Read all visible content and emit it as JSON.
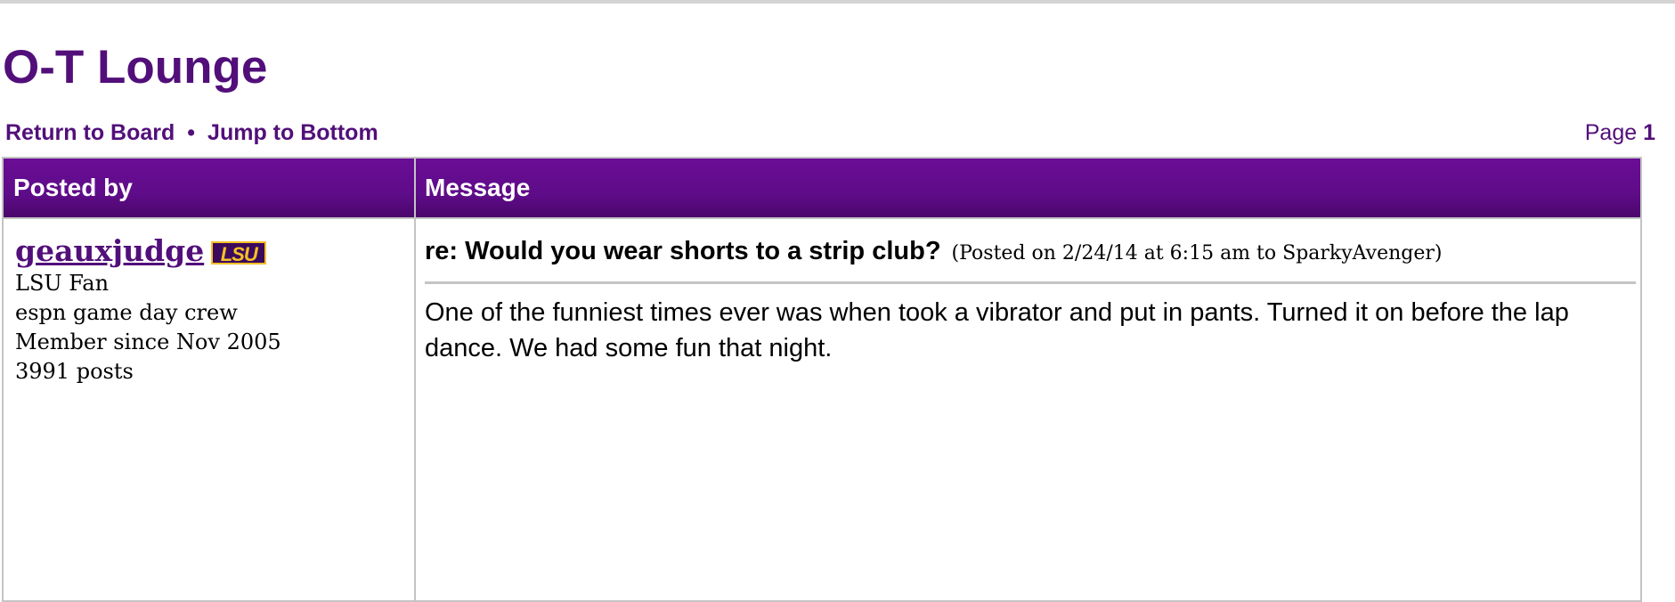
{
  "board": {
    "title": "O-T Lounge"
  },
  "nav": {
    "return_label": "Return to Board",
    "separator": "•",
    "jump_label": "Jump to Bottom"
  },
  "pager": {
    "prefix": "Page",
    "current": "1"
  },
  "table": {
    "columns": {
      "posted_by": "Posted by",
      "message": "Message"
    }
  },
  "post": {
    "author": {
      "username": "geauxjudge",
      "team_logo_text": "LSU",
      "team": "LSU Fan",
      "custom_title": "espn game day crew",
      "member_since": "Member since Nov 2005",
      "post_count": "3991 posts"
    },
    "subject": "re: Would you wear shorts to a strip club?",
    "posted_info": "(Posted on 2/24/14 at 6:15 am to SparkyAvenger)",
    "body": "One of the funniest times ever was when took a vibrator and put in pants. Turned it on before the lap dance. We had some fun that night."
  },
  "colors": {
    "brand_purple": "#520f7a",
    "header_purple": "#6a0d96",
    "lsu_gold": "#f5c026",
    "border_gray": "#c4c4c4"
  }
}
